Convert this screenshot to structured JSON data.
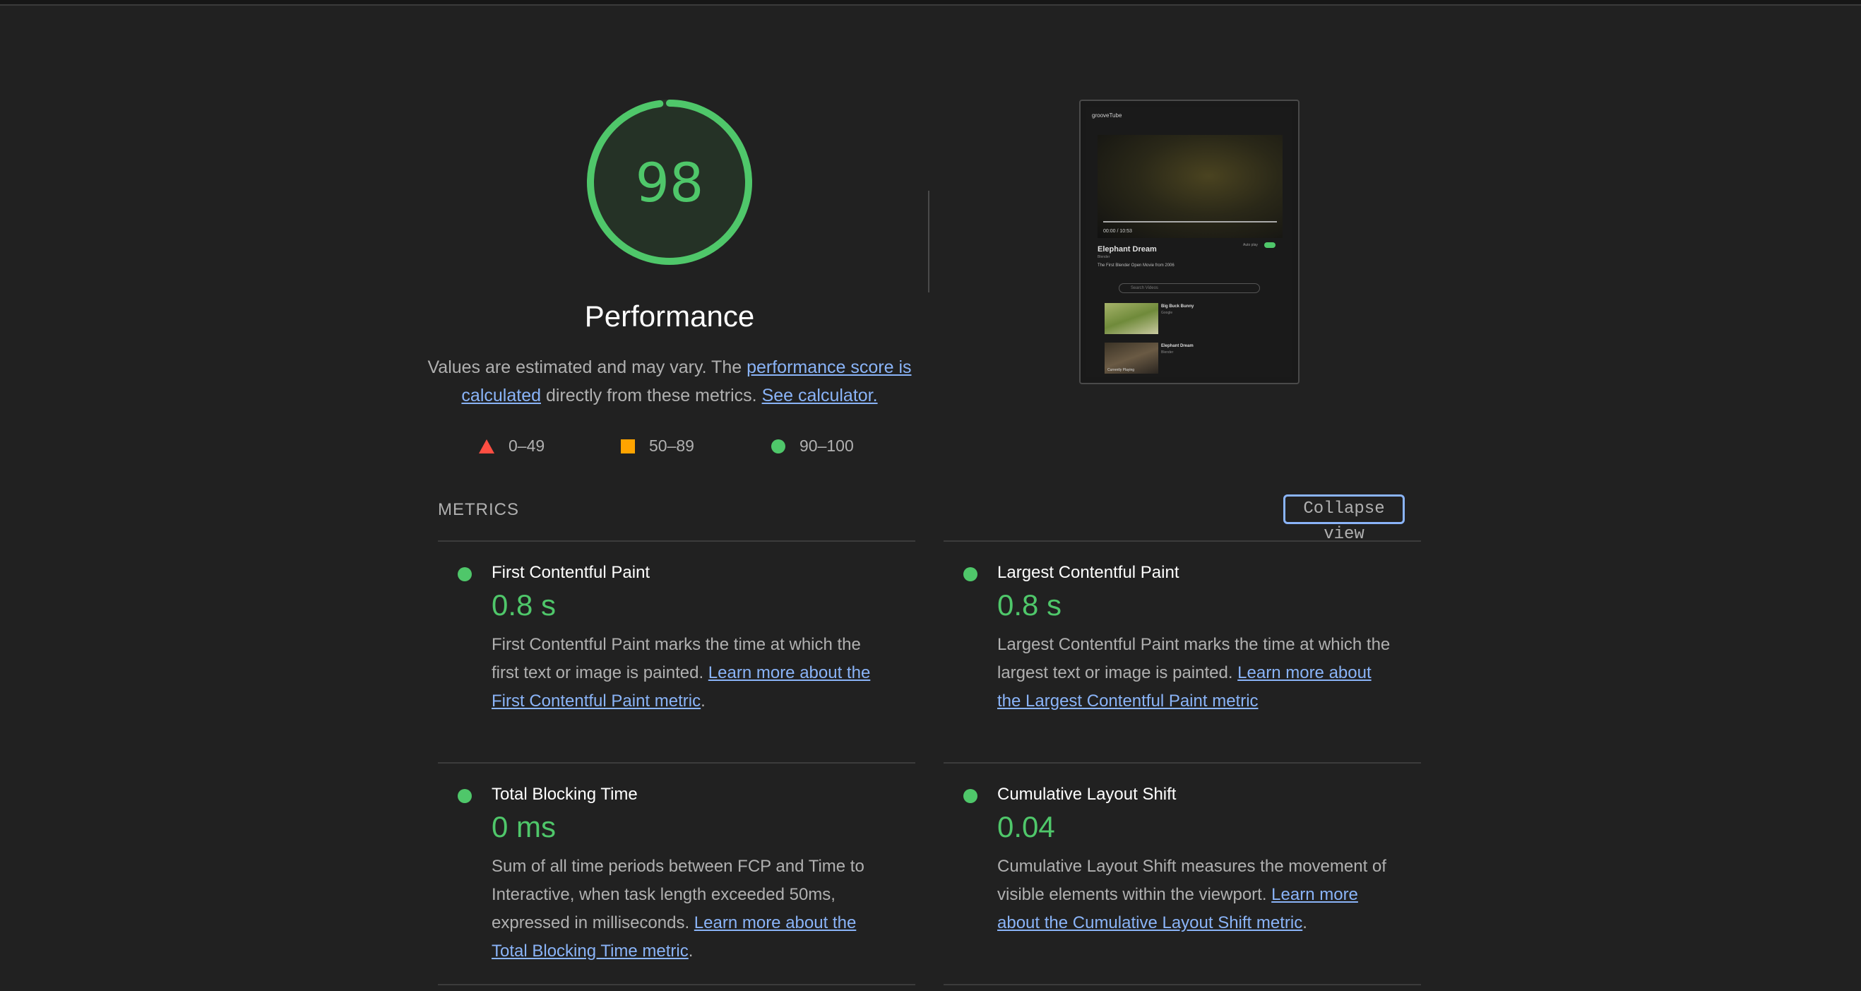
{
  "score": {
    "value": "98",
    "title": "Performance",
    "desc_prefix": "Values are estimated and may vary. The ",
    "desc_link1": "performance score is calculated",
    "desc_mid": " directly from these metrics. ",
    "desc_link2": "See calculator.",
    "fraction": 0.98,
    "color": "#4fc76a"
  },
  "legend": {
    "fail": "0–49",
    "average": "50–89",
    "pass": "90–100"
  },
  "thumbnail": {
    "brand": "grooveTube",
    "time": "00:00 / 10:53",
    "video_title": "Elephant Dream",
    "video_sub": "Blender",
    "video_desc": "The First Blender Open Movie from 2006",
    "autoplay_label": "Auto play",
    "search_placeholder": "Search Videos",
    "items": [
      {
        "name": "Big Buck Bunny",
        "by": "Google",
        "caption": ""
      },
      {
        "name": "Elephant Dream",
        "by": "Blender",
        "caption": "Currently Playing"
      }
    ]
  },
  "metrics": {
    "header": "METRICS",
    "collapse_label": "Collapse view",
    "items": [
      {
        "title": "First Contentful Paint",
        "value": "0.8 s",
        "desc": "First Contentful Paint marks the time at which the first text or image is painted. ",
        "link": "Learn more about the First Contentful Paint metric",
        "tail": "."
      },
      {
        "title": "Largest Contentful Paint",
        "value": "0.8 s",
        "desc": "Largest Contentful Paint marks the time at which the largest text or image is painted. ",
        "link": "Learn more about the Largest Contentful Paint metric",
        "tail": ""
      },
      {
        "title": "Total Blocking Time",
        "value": "0 ms",
        "desc": "Sum of all time periods between FCP and Time to Interactive, when task length exceeded 50ms, expressed in milliseconds. ",
        "link": "Learn more about the Total Blocking Time metric",
        "tail": "."
      },
      {
        "title": "Cumulative Layout Shift",
        "value": "0.04",
        "desc": "Cumulative Layout Shift measures the movement of visible elements within the viewport. ",
        "link": "Learn more about the Cumulative Layout Shift metric",
        "tail": "."
      }
    ]
  },
  "colors": {
    "pass": "#4fc76a",
    "average": "#ffa400",
    "fail": "#ff4e42",
    "link": "#8ab4f8"
  }
}
